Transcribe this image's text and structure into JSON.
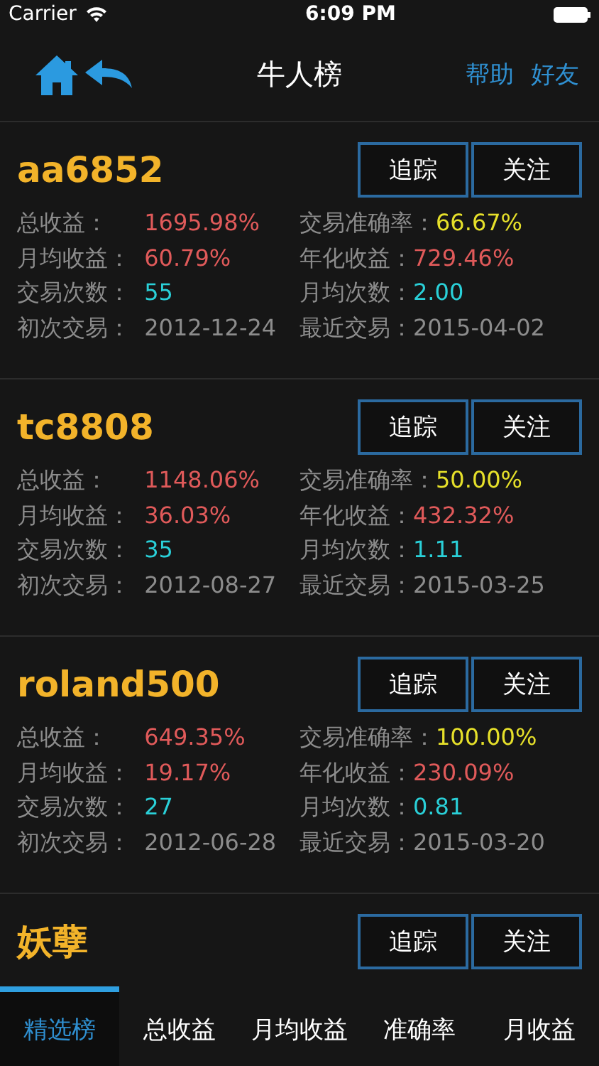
{
  "status_bar": {
    "carrier": "Carrier",
    "time": "6:09 PM"
  },
  "nav": {
    "title": "牛人榜",
    "actions": [
      "帮助",
      "好友"
    ]
  },
  "cards": [
    {
      "name": "aa6852",
      "buttons": [
        "追踪",
        "关注"
      ],
      "stats": [
        {
          "label": "总收益：",
          "value": "1695.98%",
          "color": "#e05a5a"
        },
        {
          "label": "交易准确率：",
          "value": "66.67%",
          "color": "#e6e02a"
        },
        {
          "label": "月均收益：",
          "value": "60.79%",
          "color": "#e05a5a"
        },
        {
          "label": "年化收益：",
          "value": "729.46%",
          "color": "#e05a5a"
        },
        {
          "label": "交易次数：",
          "value": "55",
          "color": "#2ad0d8"
        },
        {
          "label": "月均次数：",
          "value": "2.00",
          "color": "#2ad0d8"
        },
        {
          "label": "初次交易：",
          "value": "2012-12-24",
          "color": "#8c8c8c"
        },
        {
          "label": "最近交易：",
          "value": "2015-04-02",
          "color": "#8c8c8c"
        }
      ]
    },
    {
      "name": "tc8808",
      "buttons": [
        "追踪",
        "关注"
      ],
      "stats": [
        {
          "label": "总收益：",
          "value": "1148.06%",
          "color": "#e05a5a"
        },
        {
          "label": "交易准确率：",
          "value": "50.00%",
          "color": "#e6e02a"
        },
        {
          "label": "月均收益：",
          "value": "36.03%",
          "color": "#e05a5a"
        },
        {
          "label": "年化收益：",
          "value": "432.32%",
          "color": "#e05a5a"
        },
        {
          "label": "交易次数：",
          "value": "35",
          "color": "#2ad0d8"
        },
        {
          "label": "月均次数：",
          "value": "1.11",
          "color": "#2ad0d8"
        },
        {
          "label": "初次交易：",
          "value": "2012-08-27",
          "color": "#8c8c8c"
        },
        {
          "label": "最近交易：",
          "value": "2015-03-25",
          "color": "#8c8c8c"
        }
      ]
    },
    {
      "name": "roland500",
      "buttons": [
        "追踪",
        "关注"
      ],
      "stats": [
        {
          "label": "总收益：",
          "value": "649.35%",
          "color": "#e05a5a"
        },
        {
          "label": "交易准确率：",
          "value": "100.00%",
          "color": "#e6e02a"
        },
        {
          "label": "月均收益：",
          "value": "19.17%",
          "color": "#e05a5a"
        },
        {
          "label": "年化收益：",
          "value": "230.09%",
          "color": "#e05a5a"
        },
        {
          "label": "交易次数：",
          "value": "27",
          "color": "#2ad0d8"
        },
        {
          "label": "月均次数：",
          "value": "0.81",
          "color": "#2ad0d8"
        },
        {
          "label": "初次交易：",
          "value": "2012-06-28",
          "color": "#8c8c8c"
        },
        {
          "label": "最近交易：",
          "value": "2015-03-20",
          "color": "#8c8c8c"
        }
      ]
    },
    {
      "name": "妖孽",
      "buttons": [
        "追踪",
        "关注"
      ]
    }
  ],
  "tabs": [
    {
      "label": "精选榜",
      "selected": true
    },
    {
      "label": "总收益",
      "selected": false
    },
    {
      "label": "月均收益",
      "selected": false
    },
    {
      "label": "准确率",
      "selected": false
    },
    {
      "label": "月收益",
      "selected": false
    }
  ]
}
